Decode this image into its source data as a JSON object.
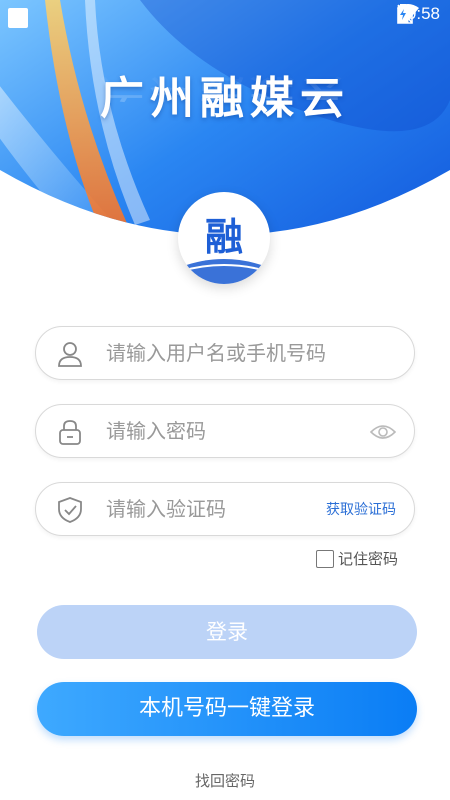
{
  "status_bar": {
    "time": "10:58",
    "icons": [
      "wifi-icon",
      "no-sim-icon",
      "battery-charging-icon"
    ]
  },
  "header": {
    "title": "广州融媒云",
    "logo_text": "融"
  },
  "colors": {
    "brand_blue": "#0a7df5",
    "header_blue": "#1a6ff0",
    "login_disabled": "#bcd3f7",
    "link_blue": "#2b6fd6"
  },
  "form": {
    "username_placeholder": "请输入用户名或手机号码",
    "password_placeholder": "请输入密码",
    "code_placeholder": "请输入验证码",
    "get_code_label": "获取验证码",
    "remember_label": "记住密码"
  },
  "buttons": {
    "login_label": "登录",
    "one_key_label": "本机号码一键登录"
  },
  "links": {
    "forgot_label": "找回密码"
  }
}
